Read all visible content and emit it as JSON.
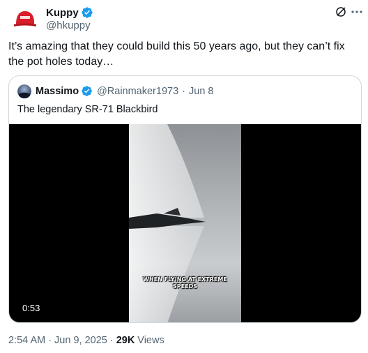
{
  "author": {
    "name": "Kuppy",
    "handle": "@hkuppy"
  },
  "tweet": {
    "text": "It’s amazing that they could build this 50 years ago, but they can’t fix the pot holes today…"
  },
  "quote": {
    "name": "Massimo",
    "handle": "@Rainmaker1973",
    "separator": "·",
    "date": "Jun 8",
    "text": "The legendary SR-71 Blackbird",
    "video": {
      "caption_line1": "WHEN FLYING AT EXTREME",
      "caption_line2": "SPEEDS",
      "duration": "0:53"
    }
  },
  "footer": {
    "time": "2:54 AM",
    "sep1": "·",
    "date": "Jun 9, 2025",
    "sep2": "·",
    "views_count": "29K",
    "views_label": "Views"
  },
  "colors": {
    "verified": "#1d9bf0",
    "secondary_text": "#536471",
    "border": "#cfd9de"
  },
  "icons": [
    "verified-badge-icon",
    "grok-icon",
    "more-icon"
  ]
}
